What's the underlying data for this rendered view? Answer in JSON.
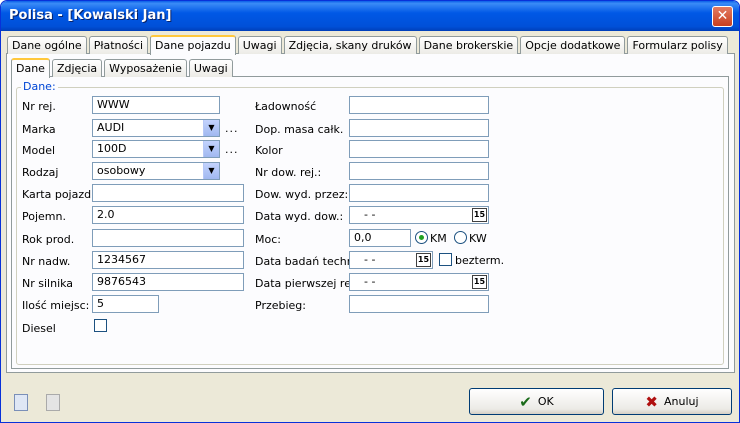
{
  "window": {
    "title": "Polisa - [Kowalski Jan]"
  },
  "tabs_top": [
    {
      "label": "Dane ogólne"
    },
    {
      "label": "Płatności"
    },
    {
      "label": "Dane pojazdu"
    },
    {
      "label": "Uwagi"
    },
    {
      "label": "Zdjęcia, skany druków"
    },
    {
      "label": "Dane brokerskie"
    },
    {
      "label": "Opcje dodatkowe"
    },
    {
      "label": "Formularz polisy"
    }
  ],
  "tabs_inner": [
    {
      "label": "Dane"
    },
    {
      "label": "Zdjęcia"
    },
    {
      "label": "Wyposażenie"
    },
    {
      "label": "Uwagi"
    }
  ],
  "group_label": "Dane:",
  "left": {
    "nr_rej": {
      "label": "Nr rej.",
      "value": "WWW"
    },
    "marka": {
      "label": "Marka",
      "value": "AUDI"
    },
    "model": {
      "label": "Model",
      "value": "100D"
    },
    "rodzaj": {
      "label": "Rodzaj",
      "value": "osobowy"
    },
    "karta": {
      "label": "Karta pojazdu:",
      "value": ""
    },
    "pojemn": {
      "label": "Pojemn.",
      "value": "2.0"
    },
    "rok": {
      "label": "Rok prod.",
      "value": ""
    },
    "nr_nadw": {
      "label": "Nr nadw.",
      "value": "1234567"
    },
    "nr_silnika": {
      "label": "Nr silnika",
      "value": "9876543"
    },
    "ilosc": {
      "label": "Ilość miejsc:",
      "value": "5"
    },
    "diesel": {
      "label": "Diesel"
    }
  },
  "right": {
    "ladownosc": {
      "label": "Ładowność",
      "value": ""
    },
    "dop_masa": {
      "label": "Dop. masa całk.",
      "value": ""
    },
    "kolor": {
      "label": "Kolor",
      "value": ""
    },
    "nr_dow": {
      "label": "Nr dow. rej.:",
      "value": ""
    },
    "dow_wyd": {
      "label": "Dow. wyd. przez:",
      "value": ""
    },
    "data_wyd": {
      "label": "Data wyd. dow.:",
      "value": "- -"
    },
    "moc": {
      "label": "Moc:",
      "value": "0,0"
    },
    "data_badan": {
      "label": "Data badań techn.:",
      "value": "- -"
    },
    "data_rej": {
      "label": "Data pierwszej rej.:",
      "value": "- -"
    },
    "przebieg": {
      "label": "Przebieg:",
      "value": ""
    }
  },
  "moc_units": {
    "km": "KM",
    "kw": "KW"
  },
  "bezterm": "bezterm.",
  "dots": "...",
  "calendar_glyph": "15",
  "buttons": {
    "ok": "OK",
    "cancel": "Anuluj"
  }
}
